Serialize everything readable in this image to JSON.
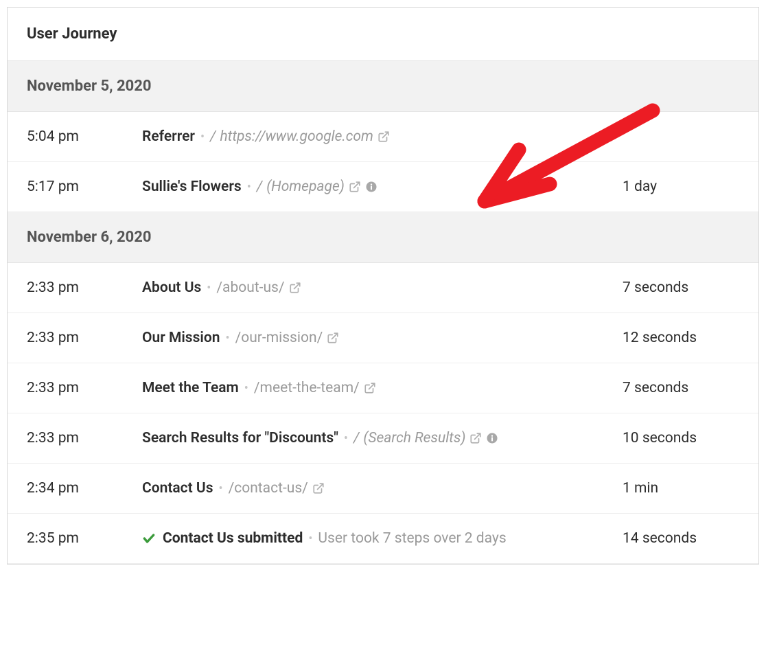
{
  "header": {
    "title": "User Journey"
  },
  "groups": [
    {
      "date": "November 5, 2020",
      "rows": [
        {
          "time": "5:04 pm",
          "title": "Referrer",
          "slash": "/",
          "path": "https://www.google.com",
          "path_style": "italic",
          "has_external": true,
          "has_info": false,
          "duration": ""
        },
        {
          "time": "5:17 pm",
          "title": "Sullie's Flowers",
          "slash": "/",
          "path": "(Homepage)",
          "path_style": "italic",
          "has_external": true,
          "has_info": true,
          "duration": "1 day"
        }
      ]
    },
    {
      "date": "November 6, 2020",
      "rows": [
        {
          "time": "2:33 pm",
          "title": "About Us",
          "slash": "",
          "path": "/about-us/",
          "path_style": "plain",
          "has_external": true,
          "has_info": false,
          "duration": "7 seconds"
        },
        {
          "time": "2:33 pm",
          "title": "Our Mission",
          "slash": "",
          "path": "/our-mission/",
          "path_style": "plain",
          "has_external": true,
          "has_info": false,
          "duration": "12 seconds"
        },
        {
          "time": "2:33 pm",
          "title": "Meet the Team",
          "slash": "",
          "path": "/meet-the-team/",
          "path_style": "plain",
          "has_external": true,
          "has_info": false,
          "duration": "7 seconds"
        },
        {
          "time": "2:33 pm",
          "title": "Search Results for \"Discounts\"",
          "slash": "/",
          "path": "(Search Results)",
          "path_style": "italic",
          "has_external": true,
          "has_info": true,
          "duration": "10 seconds"
        },
        {
          "time": "2:34 pm",
          "title": "Contact Us",
          "slash": "",
          "path": "/contact-us/",
          "path_style": "plain",
          "has_external": true,
          "has_info": false,
          "duration": "1 min"
        },
        {
          "time": "2:35 pm",
          "submitted": true,
          "submitted_title": "Contact Us submitted",
          "summary": "User took 7 steps over 2 days",
          "duration": "14 seconds"
        }
      ]
    }
  ]
}
